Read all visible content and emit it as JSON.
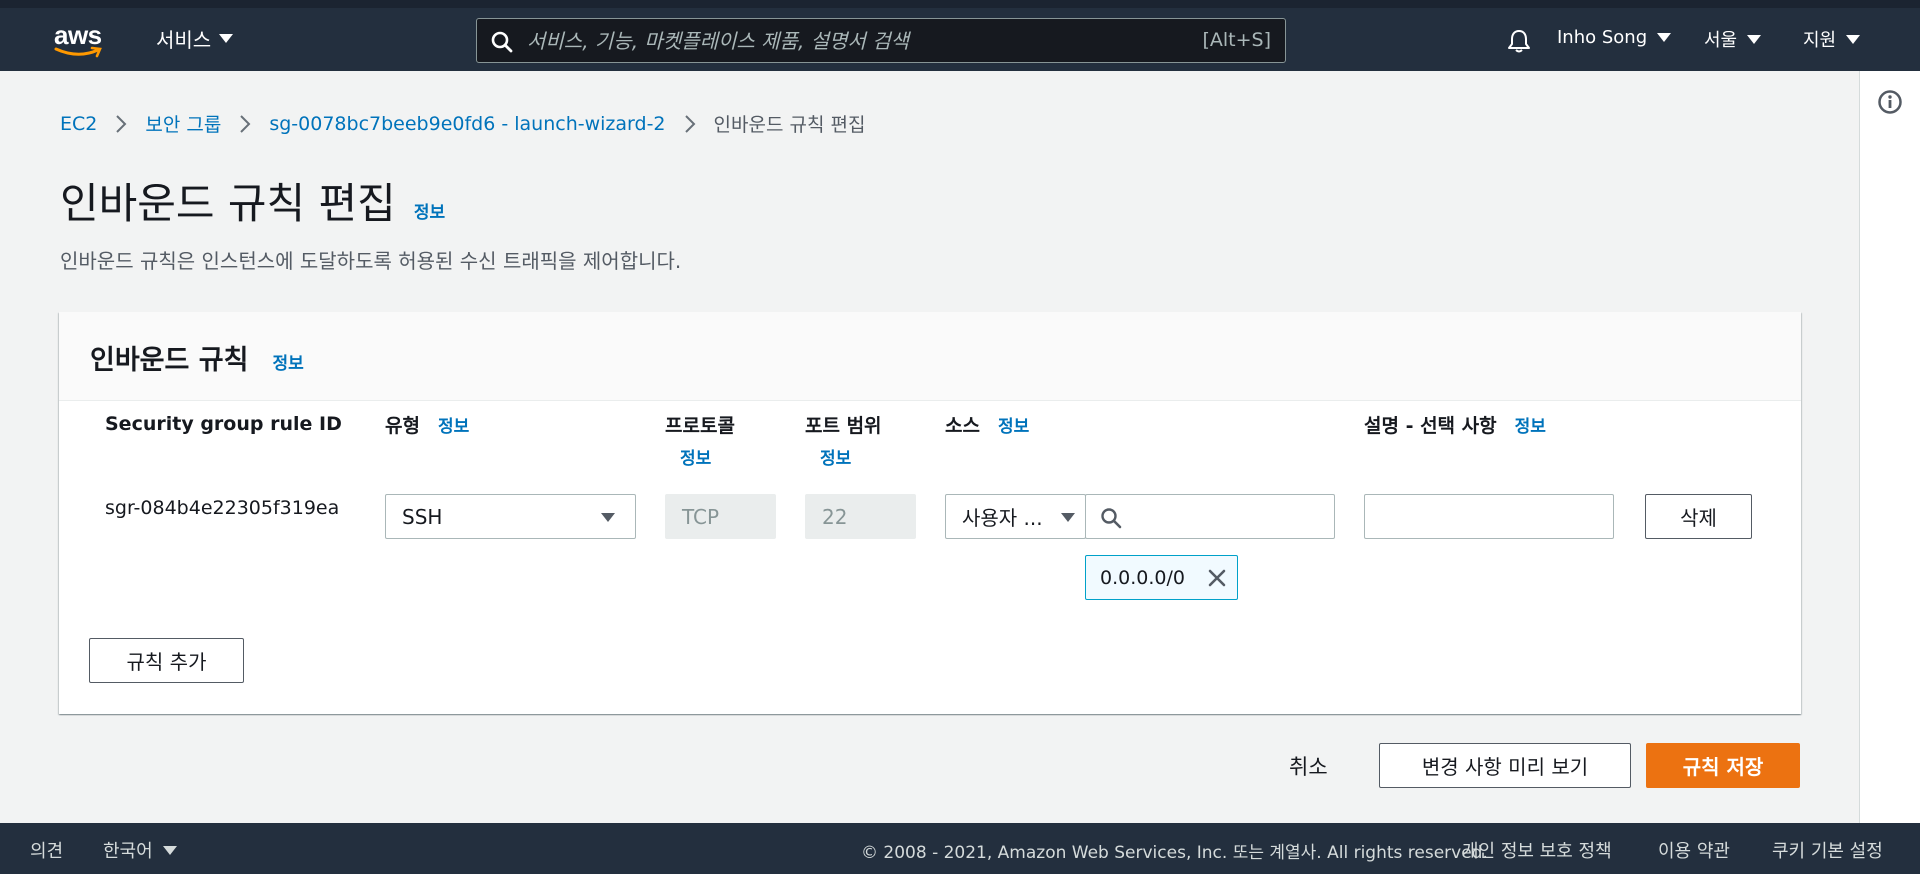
{
  "nav": {
    "logo_text": "aws",
    "services_label": "서비스",
    "search_placeholder": "서비스, 기능, 마켓플레이스 제품, 설명서 검색",
    "search_shortcut": "[Alt+S]",
    "user_name": "Inho Song",
    "region": "서울",
    "support": "지원"
  },
  "breadcrumb": {
    "items": [
      "EC2",
      "보안 그룹",
      "sg-0078bc7beeb9e0fd6 - launch-wizard-2"
    ],
    "current": "인바운드 규칙 편집"
  },
  "page": {
    "title": "인바운드 규칙 편집",
    "info": "정보",
    "description": "인바운드 규칙은 인스턴스에 도달하도록 허용된 수신 트래픽을 제어합니다."
  },
  "panel": {
    "title": "인바운드 규칙",
    "info": "정보",
    "columns": {
      "rule_id": "Security group rule ID",
      "type": "유형",
      "protocol": "프로토콜",
      "port_range": "포트 범위",
      "source": "소스",
      "description": "설명 - 선택 사항",
      "info": "정보"
    },
    "rule": {
      "id": "sgr-084b4e22305f319ea",
      "type": "SSH",
      "protocol": "TCP",
      "port": "22",
      "source_type": "사용자 ...",
      "source_token": "0.0.0.0/0",
      "description": ""
    },
    "delete_label": "삭제",
    "add_rule_label": "규칙 추가"
  },
  "actions": {
    "cancel": "취소",
    "preview": "변경 사항 미리 보기",
    "save": "규칙 저장"
  },
  "footer": {
    "feedback": "의견",
    "language": "한국어",
    "copyright": "© 2008 - 2021, Amazon Web Services, Inc. 또는 계열사. All rights reserved.",
    "privacy": "개인 정보 보호 정책",
    "terms": "이용 약관",
    "cookies": "쿠키 기본 설정"
  },
  "colors": {
    "nav_bg": "#232f3e",
    "link": "#0073bb",
    "primary": "#ec7211",
    "token_border": "#00a1c9"
  }
}
